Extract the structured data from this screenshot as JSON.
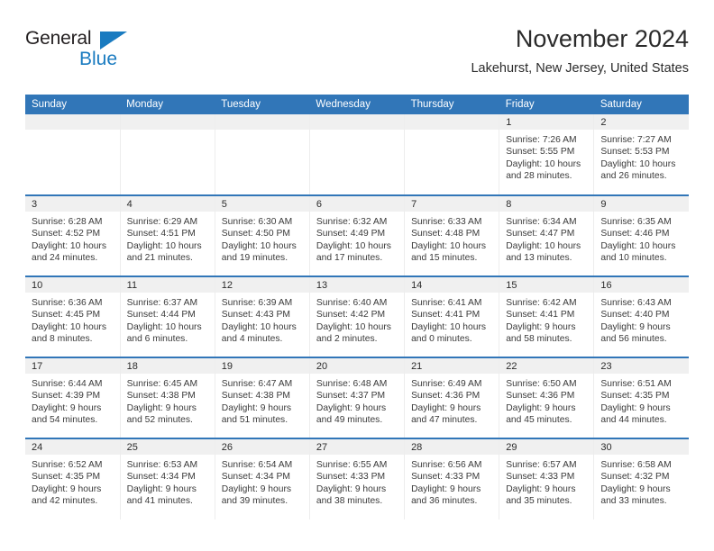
{
  "brand": {
    "name_top": "General",
    "name_bottom": "Blue",
    "triangle_icon": "blue-triangle-icon",
    "color_dark": "#231f20",
    "color_blue": "#1a7bc0"
  },
  "header": {
    "title": "November 2024",
    "subtitle": "Lakehurst, New Jersey, United States"
  },
  "theme": {
    "header_blue": "#3176b8",
    "daynum_band": "#f0f0f0",
    "cell_border": "#ededed",
    "text": "#3a3a3a"
  },
  "calendar": {
    "weekday_headers": [
      "Sunday",
      "Monday",
      "Tuesday",
      "Wednesday",
      "Thursday",
      "Friday",
      "Saturday"
    ],
    "labels": {
      "sunrise": "Sunrise:",
      "sunset": "Sunset:",
      "daylight": "Daylight:"
    },
    "weeks": [
      [
        {
          "day": "",
          "empty": true
        },
        {
          "day": "",
          "empty": true
        },
        {
          "day": "",
          "empty": true
        },
        {
          "day": "",
          "empty": true
        },
        {
          "day": "",
          "empty": true
        },
        {
          "day": "1",
          "sunrise": "Sunrise: 7:26 AM",
          "sunset": "Sunset: 5:55 PM",
          "daylight_line1": "Daylight: 10 hours",
          "daylight_line2": "and 28 minutes."
        },
        {
          "day": "2",
          "sunrise": "Sunrise: 7:27 AM",
          "sunset": "Sunset: 5:53 PM",
          "daylight_line1": "Daylight: 10 hours",
          "daylight_line2": "and 26 minutes."
        }
      ],
      [
        {
          "day": "3",
          "sunrise": "Sunrise: 6:28 AM",
          "sunset": "Sunset: 4:52 PM",
          "daylight_line1": "Daylight: 10 hours",
          "daylight_line2": "and 24 minutes."
        },
        {
          "day": "4",
          "sunrise": "Sunrise: 6:29 AM",
          "sunset": "Sunset: 4:51 PM",
          "daylight_line1": "Daylight: 10 hours",
          "daylight_line2": "and 21 minutes."
        },
        {
          "day": "5",
          "sunrise": "Sunrise: 6:30 AM",
          "sunset": "Sunset: 4:50 PM",
          "daylight_line1": "Daylight: 10 hours",
          "daylight_line2": "and 19 minutes."
        },
        {
          "day": "6",
          "sunrise": "Sunrise: 6:32 AM",
          "sunset": "Sunset: 4:49 PM",
          "daylight_line1": "Daylight: 10 hours",
          "daylight_line2": "and 17 minutes."
        },
        {
          "day": "7",
          "sunrise": "Sunrise: 6:33 AM",
          "sunset": "Sunset: 4:48 PM",
          "daylight_line1": "Daylight: 10 hours",
          "daylight_line2": "and 15 minutes."
        },
        {
          "day": "8",
          "sunrise": "Sunrise: 6:34 AM",
          "sunset": "Sunset: 4:47 PM",
          "daylight_line1": "Daylight: 10 hours",
          "daylight_line2": "and 13 minutes."
        },
        {
          "day": "9",
          "sunrise": "Sunrise: 6:35 AM",
          "sunset": "Sunset: 4:46 PM",
          "daylight_line1": "Daylight: 10 hours",
          "daylight_line2": "and 10 minutes."
        }
      ],
      [
        {
          "day": "10",
          "sunrise": "Sunrise: 6:36 AM",
          "sunset": "Sunset: 4:45 PM",
          "daylight_line1": "Daylight: 10 hours",
          "daylight_line2": "and 8 minutes."
        },
        {
          "day": "11",
          "sunrise": "Sunrise: 6:37 AM",
          "sunset": "Sunset: 4:44 PM",
          "daylight_line1": "Daylight: 10 hours",
          "daylight_line2": "and 6 minutes."
        },
        {
          "day": "12",
          "sunrise": "Sunrise: 6:39 AM",
          "sunset": "Sunset: 4:43 PM",
          "daylight_line1": "Daylight: 10 hours",
          "daylight_line2": "and 4 minutes."
        },
        {
          "day": "13",
          "sunrise": "Sunrise: 6:40 AM",
          "sunset": "Sunset: 4:42 PM",
          "daylight_line1": "Daylight: 10 hours",
          "daylight_line2": "and 2 minutes."
        },
        {
          "day": "14",
          "sunrise": "Sunrise: 6:41 AM",
          "sunset": "Sunset: 4:41 PM",
          "daylight_line1": "Daylight: 10 hours",
          "daylight_line2": "and 0 minutes."
        },
        {
          "day": "15",
          "sunrise": "Sunrise: 6:42 AM",
          "sunset": "Sunset: 4:41 PM",
          "daylight_line1": "Daylight: 9 hours",
          "daylight_line2": "and 58 minutes."
        },
        {
          "day": "16",
          "sunrise": "Sunrise: 6:43 AM",
          "sunset": "Sunset: 4:40 PM",
          "daylight_line1": "Daylight: 9 hours",
          "daylight_line2": "and 56 minutes."
        }
      ],
      [
        {
          "day": "17",
          "sunrise": "Sunrise: 6:44 AM",
          "sunset": "Sunset: 4:39 PM",
          "daylight_line1": "Daylight: 9 hours",
          "daylight_line2": "and 54 minutes."
        },
        {
          "day": "18",
          "sunrise": "Sunrise: 6:45 AM",
          "sunset": "Sunset: 4:38 PM",
          "daylight_line1": "Daylight: 9 hours",
          "daylight_line2": "and 52 minutes."
        },
        {
          "day": "19",
          "sunrise": "Sunrise: 6:47 AM",
          "sunset": "Sunset: 4:38 PM",
          "daylight_line1": "Daylight: 9 hours",
          "daylight_line2": "and 51 minutes."
        },
        {
          "day": "20",
          "sunrise": "Sunrise: 6:48 AM",
          "sunset": "Sunset: 4:37 PM",
          "daylight_line1": "Daylight: 9 hours",
          "daylight_line2": "and 49 minutes."
        },
        {
          "day": "21",
          "sunrise": "Sunrise: 6:49 AM",
          "sunset": "Sunset: 4:36 PM",
          "daylight_line1": "Daylight: 9 hours",
          "daylight_line2": "and 47 minutes."
        },
        {
          "day": "22",
          "sunrise": "Sunrise: 6:50 AM",
          "sunset": "Sunset: 4:36 PM",
          "daylight_line1": "Daylight: 9 hours",
          "daylight_line2": "and 45 minutes."
        },
        {
          "day": "23",
          "sunrise": "Sunrise: 6:51 AM",
          "sunset": "Sunset: 4:35 PM",
          "daylight_line1": "Daylight: 9 hours",
          "daylight_line2": "and 44 minutes."
        }
      ],
      [
        {
          "day": "24",
          "sunrise": "Sunrise: 6:52 AM",
          "sunset": "Sunset: 4:35 PM",
          "daylight_line1": "Daylight: 9 hours",
          "daylight_line2": "and 42 minutes."
        },
        {
          "day": "25",
          "sunrise": "Sunrise: 6:53 AM",
          "sunset": "Sunset: 4:34 PM",
          "daylight_line1": "Daylight: 9 hours",
          "daylight_line2": "and 41 minutes."
        },
        {
          "day": "26",
          "sunrise": "Sunrise: 6:54 AM",
          "sunset": "Sunset: 4:34 PM",
          "daylight_line1": "Daylight: 9 hours",
          "daylight_line2": "and 39 minutes."
        },
        {
          "day": "27",
          "sunrise": "Sunrise: 6:55 AM",
          "sunset": "Sunset: 4:33 PM",
          "daylight_line1": "Daylight: 9 hours",
          "daylight_line2": "and 38 minutes."
        },
        {
          "day": "28",
          "sunrise": "Sunrise: 6:56 AM",
          "sunset": "Sunset: 4:33 PM",
          "daylight_line1": "Daylight: 9 hours",
          "daylight_line2": "and 36 minutes."
        },
        {
          "day": "29",
          "sunrise": "Sunrise: 6:57 AM",
          "sunset": "Sunset: 4:33 PM",
          "daylight_line1": "Daylight: 9 hours",
          "daylight_line2": "and 35 minutes."
        },
        {
          "day": "30",
          "sunrise": "Sunrise: 6:58 AM",
          "sunset": "Sunset: 4:32 PM",
          "daylight_line1": "Daylight: 9 hours",
          "daylight_line2": "and 33 minutes."
        }
      ]
    ]
  }
}
